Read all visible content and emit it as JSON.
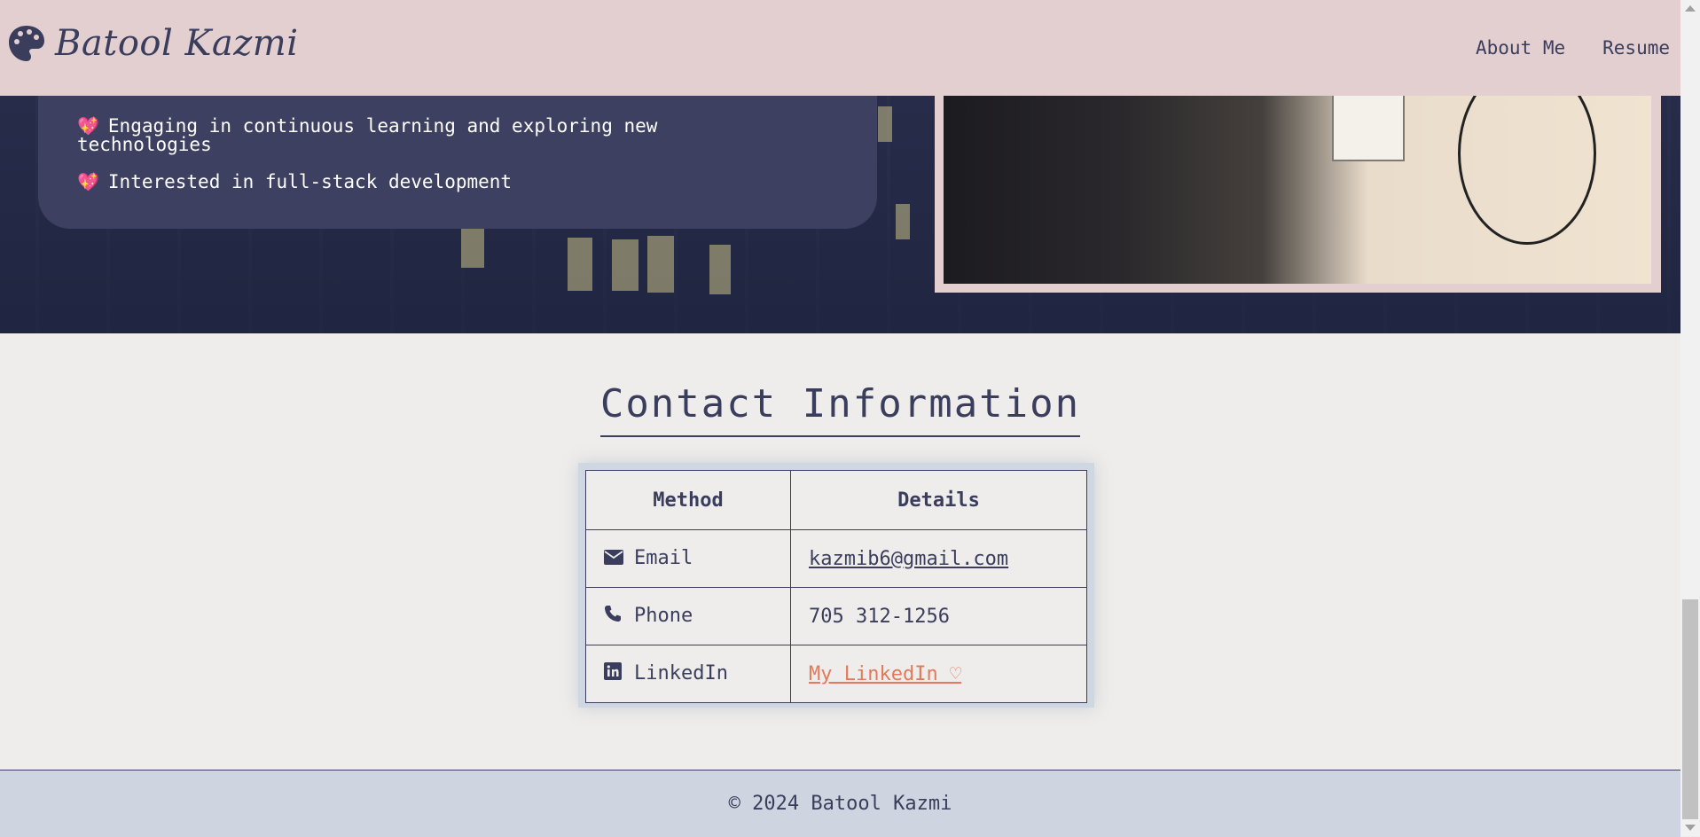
{
  "header": {
    "brand_name": "Batool Kazmi",
    "nav": [
      "About Me",
      "Resume"
    ]
  },
  "about": {
    "items": [
      "Engaging in continuous learning and exploring new technologies",
      "Interested in full-stack development"
    ]
  },
  "contact": {
    "title": "Contact Information",
    "columns": [
      "Method",
      "Details"
    ],
    "rows": [
      {
        "method": "Email",
        "icon": "envelope-icon",
        "details": "kazmib6@gmail.com"
      },
      {
        "method": "Phone",
        "icon": "phone-icon",
        "details": "705 312-1256"
      },
      {
        "method": "LinkedIn",
        "icon": "linkedin-icon",
        "details": "My LinkedIn ♡"
      }
    ]
  },
  "footer": {
    "text": "© 2024 Batool Kazmi"
  },
  "colors": {
    "header_bg": "#e3cfd0",
    "page_bg": "#efedeb",
    "text": "#3a3e5c",
    "link_accent": "#e07b5a",
    "footer_bg": "#ced5e0"
  }
}
